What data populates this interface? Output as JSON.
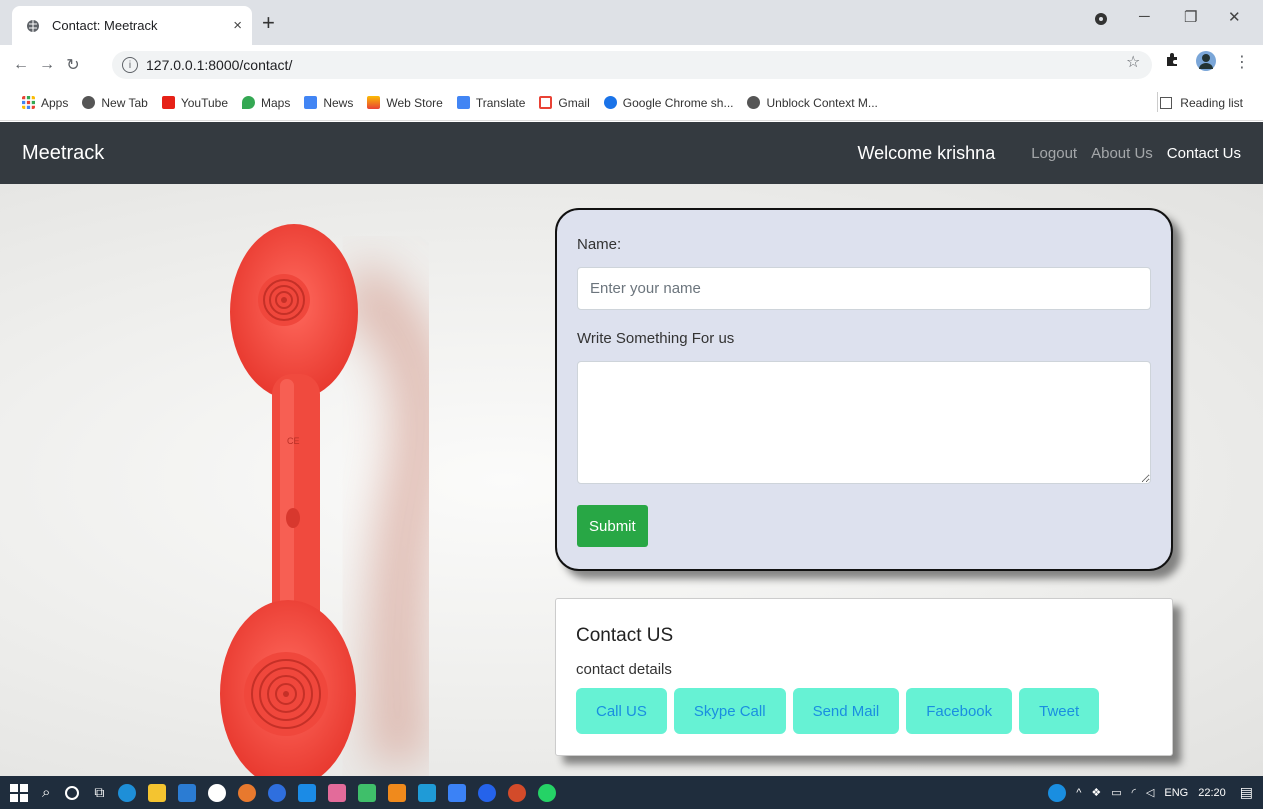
{
  "browser": {
    "tab_title": "Contact: Meetrack",
    "tab_close": "×",
    "new_tab": "+",
    "url": "127.0.0.1:8000/contact/",
    "bookmarks": [
      "Apps",
      "New Tab",
      "YouTube",
      "Maps",
      "News",
      "Web Store",
      "Translate",
      "Gmail",
      "Google Chrome sh...",
      "Unblock Context M..."
    ],
    "reading_list": "Reading list"
  },
  "navbar": {
    "brand": "Meetrack",
    "welcome": "Welcome krishna",
    "links": [
      "Logout",
      "About Us",
      "Contact Us"
    ]
  },
  "form": {
    "name_label": "Name:",
    "name_placeholder": "Enter your name",
    "message_label": "Write Something For us",
    "submit_label": "Submit"
  },
  "contact": {
    "title": "Contact US",
    "subtitle": "contact details",
    "buttons": [
      "Call US",
      "Skype Call",
      "Send Mail",
      "Facebook",
      "Tweet"
    ]
  },
  "taskbar": {
    "lang": "ENG",
    "time": "22:20"
  },
  "colors": {
    "navbar_bg": "#343a40",
    "submit_bg": "#28a745",
    "contact_btn_bg": "#66f2d4",
    "contact_btn_text": "#1a8ee0",
    "phone_red": "#f2463d"
  }
}
